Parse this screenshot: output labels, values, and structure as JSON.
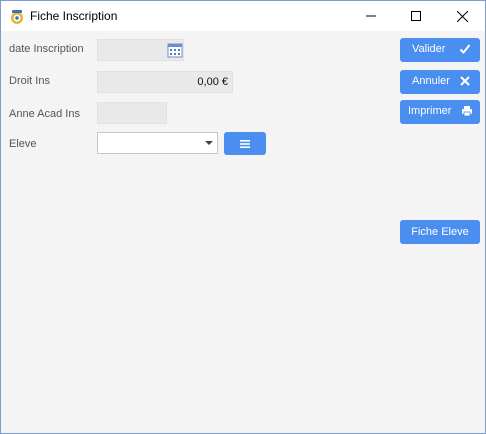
{
  "window": {
    "title": "Fiche Inscription",
    "icon": "app-gear-icon",
    "controls": {
      "minimize": "minimize-icon",
      "maximize": "maximize-icon",
      "close": "close-icon"
    }
  },
  "form": {
    "date_inscription": {
      "label": "date Inscription",
      "value": "",
      "icon": "calendar-icon"
    },
    "droit_ins": {
      "label": "Droit Ins",
      "value": "0,00 €"
    },
    "anne_acad_ins": {
      "label": "Anne Acad Ins",
      "value": ""
    },
    "eleve": {
      "label": "Eleve",
      "value": "",
      "list_icon": "list-icon"
    }
  },
  "actions": {
    "valider": {
      "label": "Valider",
      "icon": "check-icon"
    },
    "annuler": {
      "label": "Annuler",
      "icon": "x-icon"
    },
    "imprimer": {
      "label": "Imprimer",
      "icon": "printer-icon"
    },
    "fiche_eleve": {
      "label": "Fiche Eleve"
    }
  },
  "colors": {
    "accent": "#4a8ff0",
    "background": "#f4f4f4",
    "field": "#e9e9e9"
  }
}
